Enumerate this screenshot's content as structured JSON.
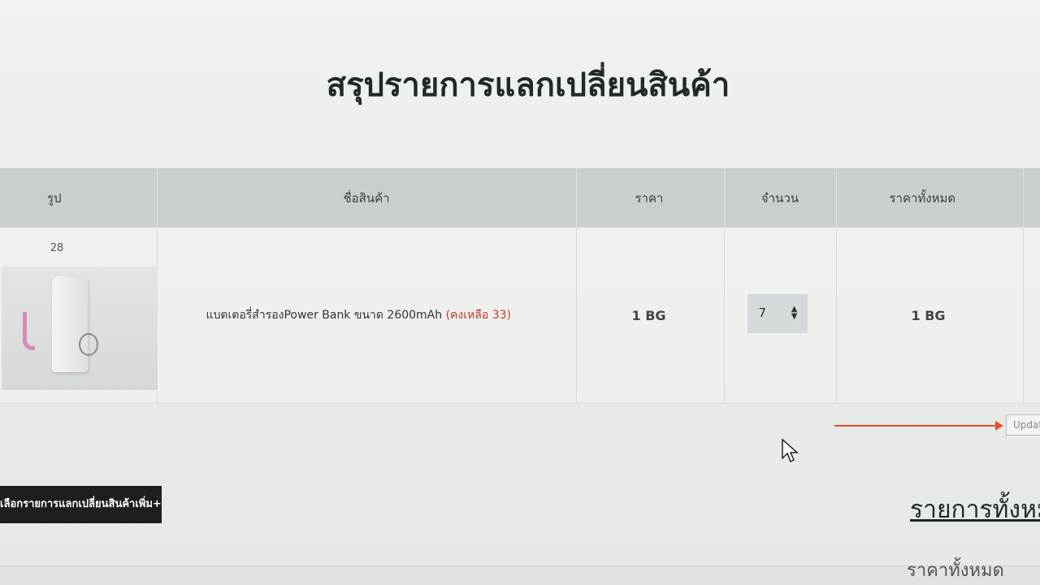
{
  "page": {
    "title": "สรุปรายการแลกเปลี่ยนสินค้า"
  },
  "table": {
    "headers": {
      "image": "รูป",
      "name": "ชื่อสินค้า",
      "price": "ราคา",
      "quantity": "จำนวน",
      "total": "ราคาทั้งหมด"
    },
    "rows": [
      {
        "id": "28",
        "name": "แบตเตอรี่สำรองPower Bank ขนาด 2600mAh",
        "stock_note": "(คงเหลือ 33)",
        "price": "1 BG",
        "quantity": "7",
        "total": "1 BG"
      }
    ]
  },
  "actions": {
    "update_label": "Update",
    "more_label": "เลือกรายการแลกเปลี่ยนสินค้าเพิ่ม+"
  },
  "summary": {
    "title": "รายการทั้งหมด",
    "total_label": "ราคาทั้งหมด"
  },
  "colors": {
    "header_bg": "#c9cfcd",
    "stock_note": "#c0392b",
    "arrow": "#e5502b",
    "dark_button": "#1c1f1f"
  }
}
